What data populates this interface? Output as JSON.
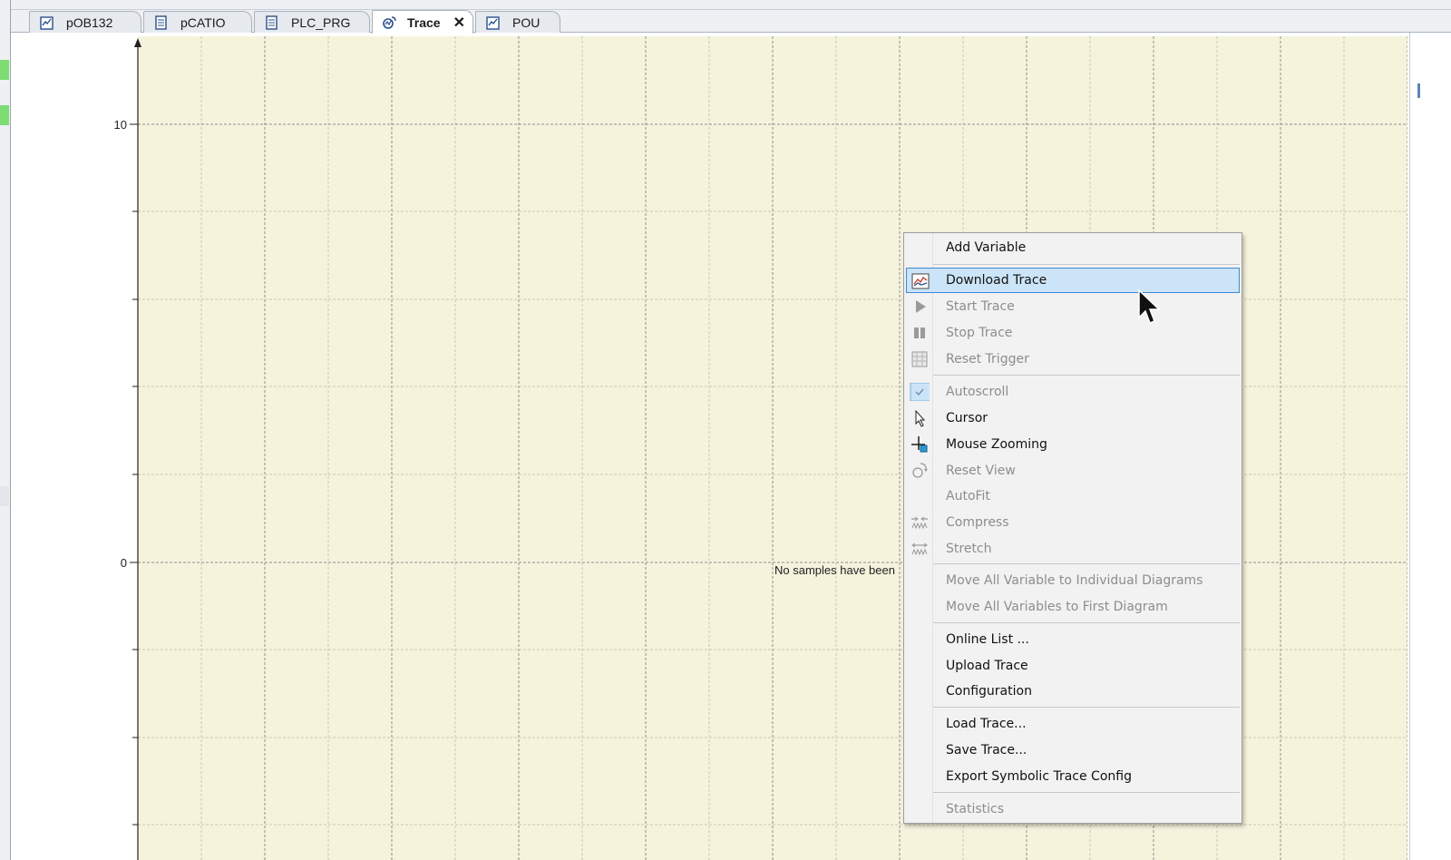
{
  "tabs": [
    {
      "label": "pOB132",
      "icon": "pou-icon"
    },
    {
      "label": "pCATIO",
      "icon": "document-icon"
    },
    {
      "label": "PLC_PRG",
      "icon": "document-icon"
    },
    {
      "label": "Trace",
      "icon": "trace-icon",
      "active": true,
      "close": "✕"
    },
    {
      "label": "POU",
      "icon": "pou-icon"
    }
  ],
  "chart": {
    "y_tick_labels": [
      "10",
      "0"
    ],
    "empty_message": "No samples have been"
  },
  "chart_data": {
    "type": "line",
    "series": [],
    "yticks": [
      10,
      0
    ],
    "grid": true
  },
  "context_menu": {
    "items": [
      {
        "label": "Add Variable",
        "enabled": true
      },
      {
        "label": "Download Trace",
        "enabled": true,
        "highlighted": true,
        "icon": "download-trace-icon"
      },
      {
        "label": "Start Trace",
        "enabled": false,
        "icon": "play-icon"
      },
      {
        "label": "Stop Trace",
        "enabled": false,
        "icon": "pause-icon"
      },
      {
        "label": "Reset Trigger",
        "enabled": false,
        "icon": "reset-trigger-icon"
      },
      {
        "label": "Autoscroll",
        "enabled": false,
        "checked": true,
        "icon": "checkmark-icon"
      },
      {
        "label": "Cursor",
        "enabled": true,
        "icon": "cursor-icon"
      },
      {
        "label": "Mouse Zooming",
        "enabled": true,
        "icon": "zoom-icon"
      },
      {
        "label": "Reset View",
        "enabled": false,
        "icon": "reset-view-icon"
      },
      {
        "label": "AutoFit",
        "enabled": false
      },
      {
        "label": "Compress",
        "enabled": false,
        "icon": "compress-icon"
      },
      {
        "label": "Stretch",
        "enabled": false,
        "icon": "stretch-icon"
      },
      {
        "label": "Move All Variable to Individual Diagrams",
        "enabled": false
      },
      {
        "label": "Move All Variables to First Diagram",
        "enabled": false
      },
      {
        "label": "Online List ...",
        "enabled": true
      },
      {
        "label": "Upload Trace",
        "enabled": true
      },
      {
        "label": "Configuration",
        "enabled": true
      },
      {
        "label": "Load Trace...",
        "enabled": true
      },
      {
        "label": "Save Trace...",
        "enabled": true
      },
      {
        "label": "Export Symbolic Trace Config",
        "enabled": true
      },
      {
        "label": "Statistics",
        "enabled": false
      }
    ]
  },
  "colors": {
    "plot_background": "#f5f3dc",
    "grid": "#8f8f8f",
    "menu_highlight": "#cce4f7",
    "menu_highlight_border": "#3d8bd6",
    "status_green": "#7ddc72"
  }
}
